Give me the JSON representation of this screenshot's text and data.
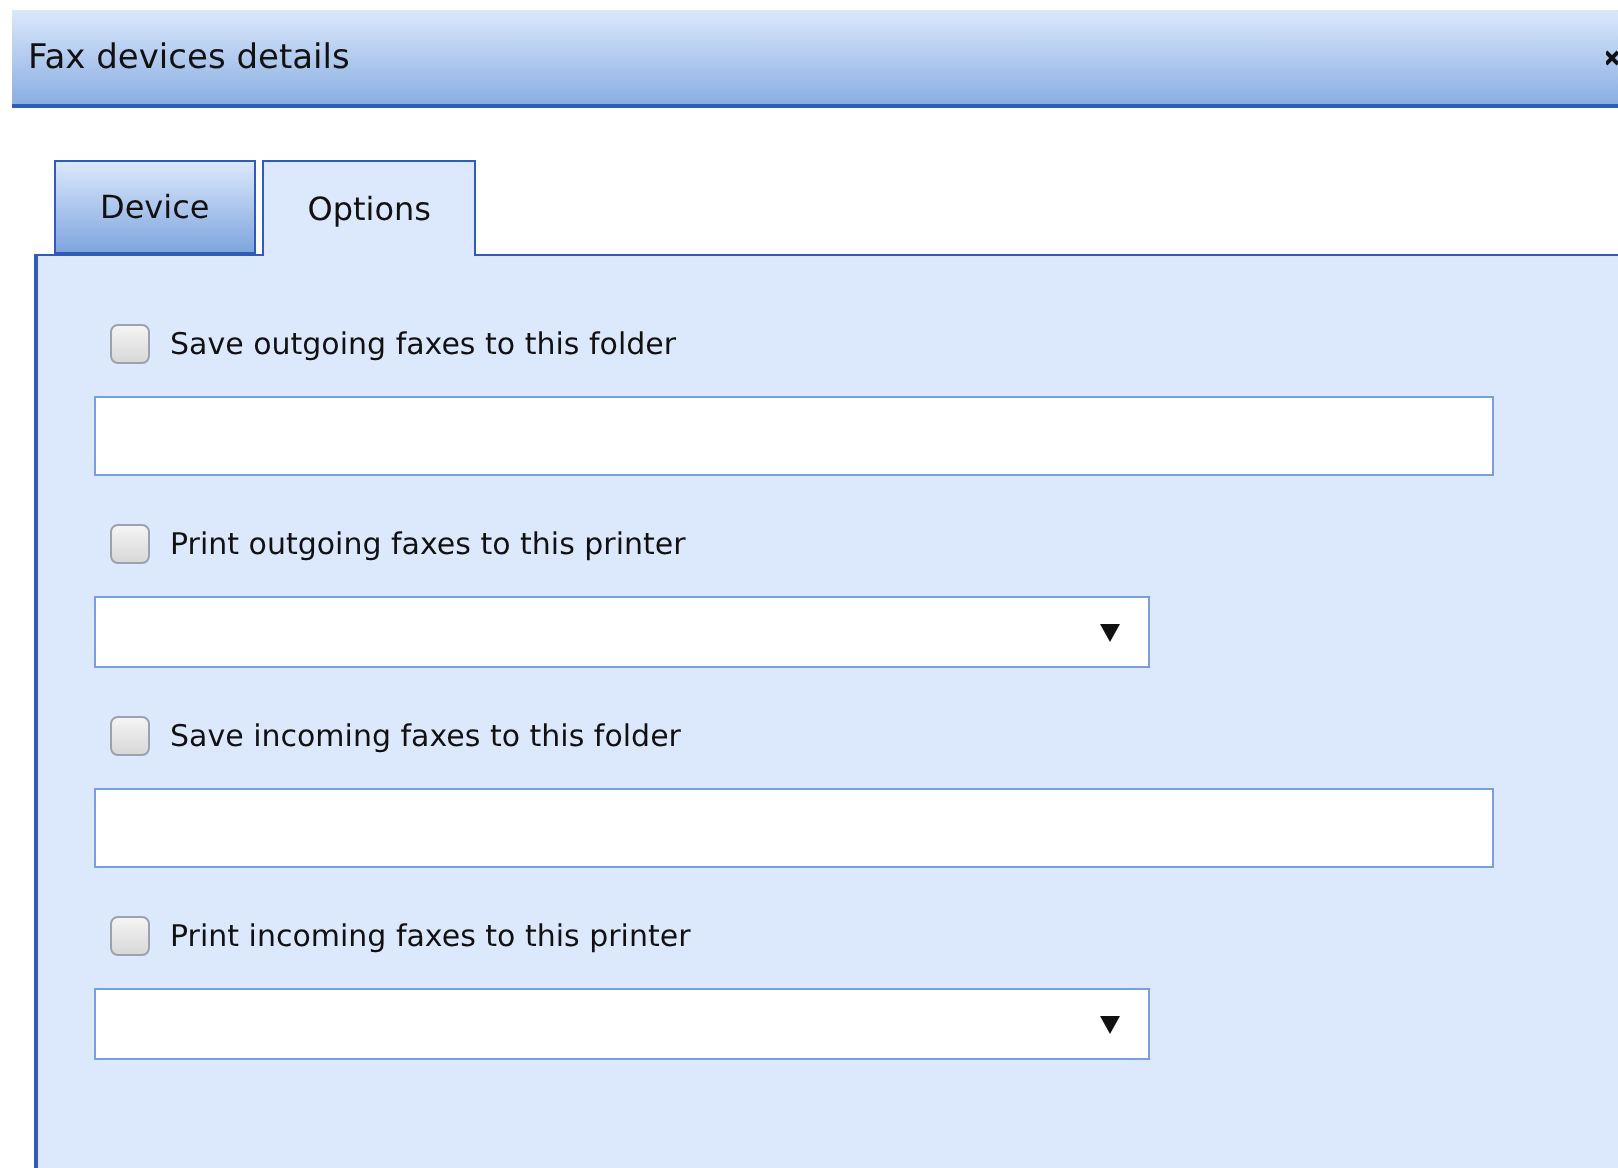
{
  "window": {
    "title": "Fax devices details"
  },
  "tabs": [
    {
      "label": "Device",
      "selected": false
    },
    {
      "label": "Options",
      "selected": true
    }
  ],
  "options": [
    {
      "label": "Save outgoing faxes to this folder",
      "checked": false,
      "kind": "text"
    },
    {
      "label": "Print outgoing faxes to this printer",
      "checked": false,
      "kind": "select"
    },
    {
      "label": "Save incoming faxes to this folder",
      "checked": false,
      "kind": "text"
    },
    {
      "label": "Print incoming faxes to this printer",
      "checked": false,
      "kind": "select"
    }
  ]
}
